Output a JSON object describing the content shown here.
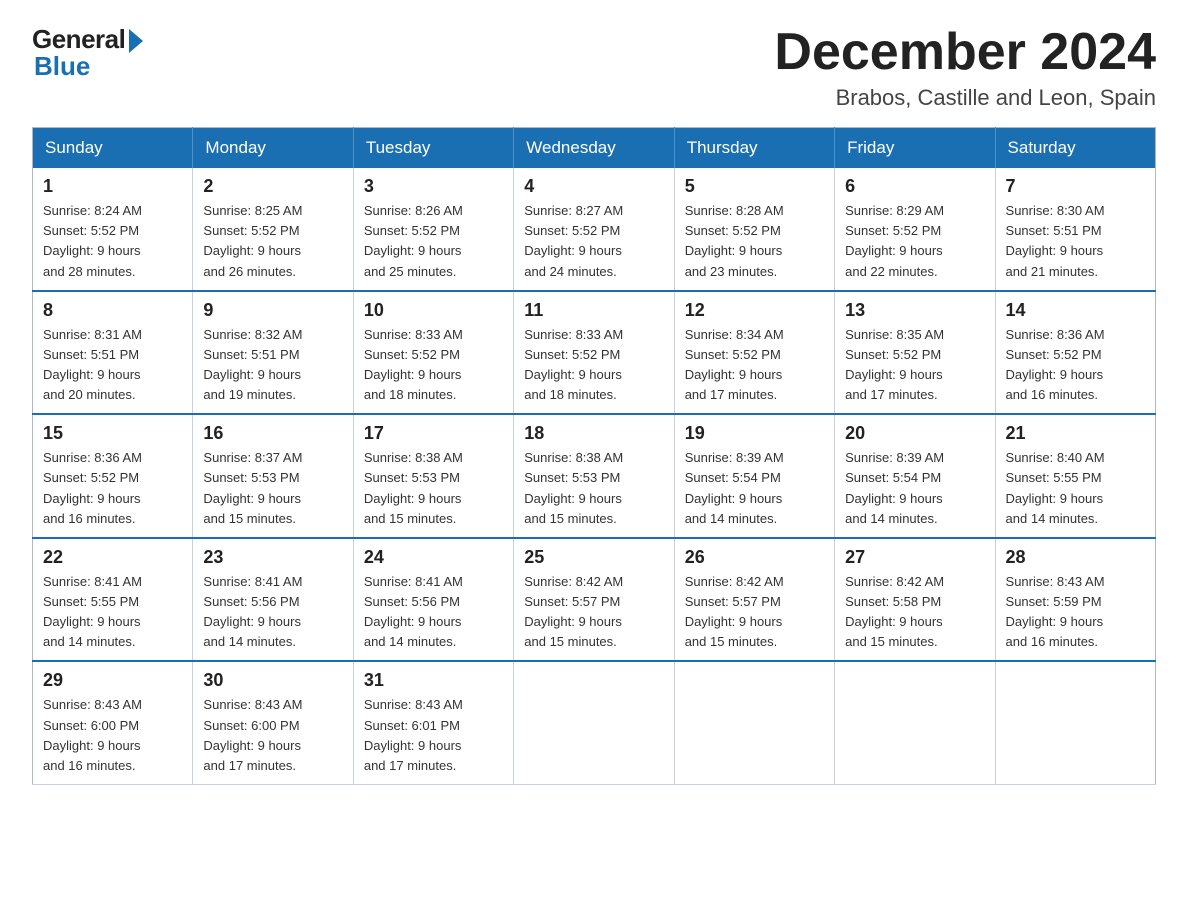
{
  "logo": {
    "general": "General",
    "blue": "Blue"
  },
  "title": "December 2024",
  "location": "Brabos, Castille and Leon, Spain",
  "weekdays": [
    "Sunday",
    "Monday",
    "Tuesday",
    "Wednesday",
    "Thursday",
    "Friday",
    "Saturday"
  ],
  "weeks": [
    [
      {
        "day": "1",
        "sunrise": "8:24 AM",
        "sunset": "5:52 PM",
        "daylight": "9 hours and 28 minutes."
      },
      {
        "day": "2",
        "sunrise": "8:25 AM",
        "sunset": "5:52 PM",
        "daylight": "9 hours and 26 minutes."
      },
      {
        "day": "3",
        "sunrise": "8:26 AM",
        "sunset": "5:52 PM",
        "daylight": "9 hours and 25 minutes."
      },
      {
        "day": "4",
        "sunrise": "8:27 AM",
        "sunset": "5:52 PM",
        "daylight": "9 hours and 24 minutes."
      },
      {
        "day": "5",
        "sunrise": "8:28 AM",
        "sunset": "5:52 PM",
        "daylight": "9 hours and 23 minutes."
      },
      {
        "day": "6",
        "sunrise": "8:29 AM",
        "sunset": "5:52 PM",
        "daylight": "9 hours and 22 minutes."
      },
      {
        "day": "7",
        "sunrise": "8:30 AM",
        "sunset": "5:51 PM",
        "daylight": "9 hours and 21 minutes."
      }
    ],
    [
      {
        "day": "8",
        "sunrise": "8:31 AM",
        "sunset": "5:51 PM",
        "daylight": "9 hours and 20 minutes."
      },
      {
        "day": "9",
        "sunrise": "8:32 AM",
        "sunset": "5:51 PM",
        "daylight": "9 hours and 19 minutes."
      },
      {
        "day": "10",
        "sunrise": "8:33 AM",
        "sunset": "5:52 PM",
        "daylight": "9 hours and 18 minutes."
      },
      {
        "day": "11",
        "sunrise": "8:33 AM",
        "sunset": "5:52 PM",
        "daylight": "9 hours and 18 minutes."
      },
      {
        "day": "12",
        "sunrise": "8:34 AM",
        "sunset": "5:52 PM",
        "daylight": "9 hours and 17 minutes."
      },
      {
        "day": "13",
        "sunrise": "8:35 AM",
        "sunset": "5:52 PM",
        "daylight": "9 hours and 17 minutes."
      },
      {
        "day": "14",
        "sunrise": "8:36 AM",
        "sunset": "5:52 PM",
        "daylight": "9 hours and 16 minutes."
      }
    ],
    [
      {
        "day": "15",
        "sunrise": "8:36 AM",
        "sunset": "5:52 PM",
        "daylight": "9 hours and 16 minutes."
      },
      {
        "day": "16",
        "sunrise": "8:37 AM",
        "sunset": "5:53 PM",
        "daylight": "9 hours and 15 minutes."
      },
      {
        "day": "17",
        "sunrise": "8:38 AM",
        "sunset": "5:53 PM",
        "daylight": "9 hours and 15 minutes."
      },
      {
        "day": "18",
        "sunrise": "8:38 AM",
        "sunset": "5:53 PM",
        "daylight": "9 hours and 15 minutes."
      },
      {
        "day": "19",
        "sunrise": "8:39 AM",
        "sunset": "5:54 PM",
        "daylight": "9 hours and 14 minutes."
      },
      {
        "day": "20",
        "sunrise": "8:39 AM",
        "sunset": "5:54 PM",
        "daylight": "9 hours and 14 minutes."
      },
      {
        "day": "21",
        "sunrise": "8:40 AM",
        "sunset": "5:55 PM",
        "daylight": "9 hours and 14 minutes."
      }
    ],
    [
      {
        "day": "22",
        "sunrise": "8:41 AM",
        "sunset": "5:55 PM",
        "daylight": "9 hours and 14 minutes."
      },
      {
        "day": "23",
        "sunrise": "8:41 AM",
        "sunset": "5:56 PM",
        "daylight": "9 hours and 14 minutes."
      },
      {
        "day": "24",
        "sunrise": "8:41 AM",
        "sunset": "5:56 PM",
        "daylight": "9 hours and 14 minutes."
      },
      {
        "day": "25",
        "sunrise": "8:42 AM",
        "sunset": "5:57 PM",
        "daylight": "9 hours and 15 minutes."
      },
      {
        "day": "26",
        "sunrise": "8:42 AM",
        "sunset": "5:57 PM",
        "daylight": "9 hours and 15 minutes."
      },
      {
        "day": "27",
        "sunrise": "8:42 AM",
        "sunset": "5:58 PM",
        "daylight": "9 hours and 15 minutes."
      },
      {
        "day": "28",
        "sunrise": "8:43 AM",
        "sunset": "5:59 PM",
        "daylight": "9 hours and 16 minutes."
      }
    ],
    [
      {
        "day": "29",
        "sunrise": "8:43 AM",
        "sunset": "6:00 PM",
        "daylight": "9 hours and 16 minutes."
      },
      {
        "day": "30",
        "sunrise": "8:43 AM",
        "sunset": "6:00 PM",
        "daylight": "9 hours and 17 minutes."
      },
      {
        "day": "31",
        "sunrise": "8:43 AM",
        "sunset": "6:01 PM",
        "daylight": "9 hours and 17 minutes."
      },
      null,
      null,
      null,
      null
    ]
  ],
  "labels": {
    "sunrise": "Sunrise:",
    "sunset": "Sunset:",
    "daylight": "Daylight:"
  }
}
